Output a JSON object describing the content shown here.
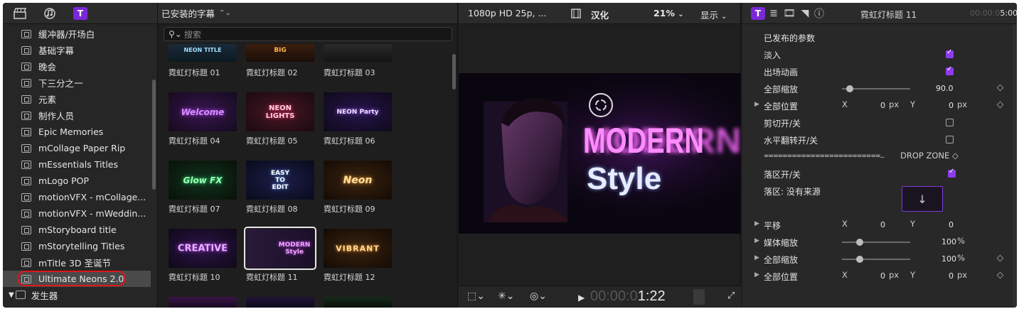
{
  "sidebar": {
    "items": [
      {
        "label": "缓冲器/开场白"
      },
      {
        "label": "基础字幕"
      },
      {
        "label": "晚会"
      },
      {
        "label": "下三分之一"
      },
      {
        "label": "元素"
      },
      {
        "label": "制作人员"
      },
      {
        "label": "Epic Memories"
      },
      {
        "label": "mCollage Paper Rip"
      },
      {
        "label": "mEssentials Titles"
      },
      {
        "label": "mLogo POP"
      },
      {
        "label": "motionVFX - mCollage..."
      },
      {
        "label": "motionVFX - mWeddin..."
      },
      {
        "label": "mStoryboard title"
      },
      {
        "label": "mStorytelling Titles"
      },
      {
        "label": "mTitle 3D 圣诞节"
      },
      {
        "label": "Ultimate Neons 2.0"
      }
    ],
    "group_label": "发生器",
    "titles_icon_letter": "T"
  },
  "browser": {
    "title": "已安装的字幕",
    "search_placeholder": "搜索",
    "thumbs": [
      {
        "label": "霓虹灯标题 01",
        "art": "NEON TITLE"
      },
      {
        "label": "霓虹灯标题 02",
        "art": "BIG"
      },
      {
        "label": "霓虹灯标题 03",
        "art": ""
      },
      {
        "label": "霓虹灯标题 04",
        "art": "Welcome"
      },
      {
        "label": "霓虹灯标题 05",
        "art": "NEON LIGHTS"
      },
      {
        "label": "霓虹灯标题 06",
        "art": "NEON Party"
      },
      {
        "label": "霓虹灯标题 07",
        "art": "Glow FX"
      },
      {
        "label": "霓虹灯标题 08",
        "art": "EASY TO EDIT"
      },
      {
        "label": "霓虹灯标题 09",
        "art": "Neon"
      },
      {
        "label": "霓虹灯标题 10",
        "art": "CREATIVE"
      },
      {
        "label": "霓虹灯标题 11",
        "art": "MODERN Style"
      },
      {
        "label": "霓虹灯标题 12",
        "art": "VIBRANT"
      }
    ]
  },
  "viewer": {
    "format": "1080p HD 25p, ...",
    "hanhua": "汉化",
    "zoom": "21%",
    "display": "显示",
    "timecode_dim": "00:00:0",
    "timecode_on": "1:22",
    "frame_title_line1": "MODERN",
    "frame_title_line2": "Style"
  },
  "inspector": {
    "title": "霓虹灯标题 11",
    "time_dim": "00:00:0",
    "time_on": "5:00",
    "section": "已发布的参数",
    "fade_in": "淡入",
    "exit_anim": "出场动画",
    "scale_all": "全部缩放",
    "scale_all_value": "90.0",
    "pos_all": "全部位置",
    "x": "X",
    "y": "Y",
    "zero": "0",
    "px": "px",
    "clip_toggle": "剪切开/关",
    "hflip_toggle": "水平翻转开/关",
    "drop_zone_line": "=========================...",
    "drop_zone": "DROP ZONE ◇",
    "drop_toggle": "落区开/关",
    "drop_source": "落区: 没有来源",
    "translate": "平移",
    "media_scale": "媒体缩放",
    "media_scale_value": "100",
    "scale_all2_value": "100",
    "percent": "%",
    "pos_all2": "全部位置"
  },
  "colors": {
    "accent_purple": "#8e3bef",
    "highlight_red": "#e0141c"
  }
}
